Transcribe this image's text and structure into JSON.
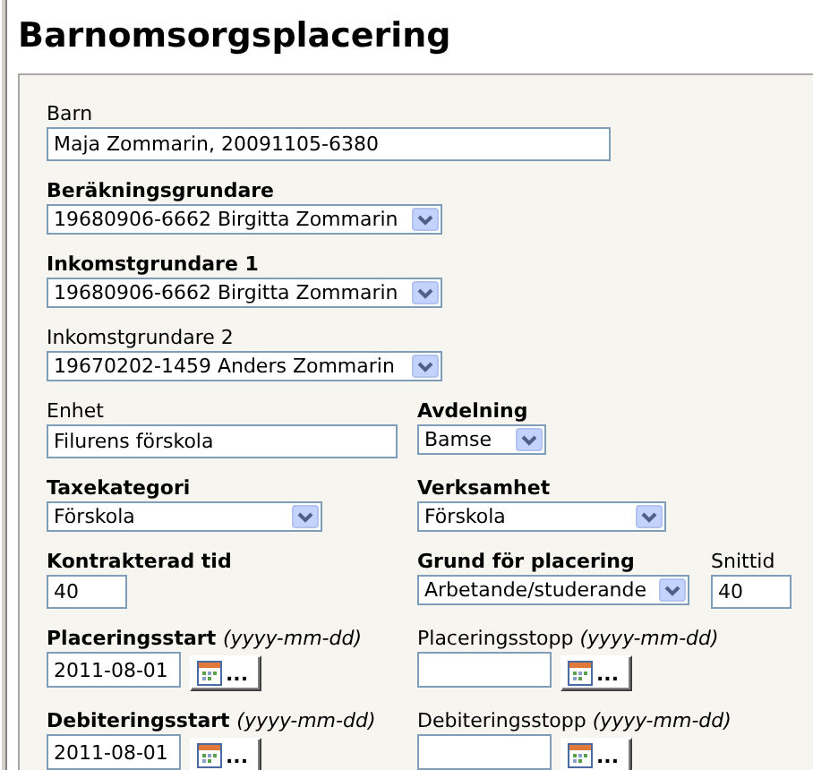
{
  "title": "Barnomsorgsplacering",
  "rows": [
    [
      {
        "kind": "text",
        "label": "Barn",
        "bold": false,
        "value": "Maja Zommarin, 20091105-6380"
      }
    ],
    [
      {
        "kind": "select",
        "label": "Beräkningsgrundare",
        "bold": true,
        "value": "19680906-6662 Birgitta Zommarin"
      }
    ],
    [
      {
        "kind": "select",
        "label": "Inkomstgrundare 1",
        "bold": true,
        "value": "19680906-6662 Birgitta Zommarin"
      }
    ],
    [
      {
        "kind": "select",
        "label": "Inkomstgrundare 2",
        "bold": false,
        "value": "19670202-1459 Anders Zommarin"
      }
    ],
    [
      {
        "kind": "text",
        "label": "Enhet",
        "bold": false,
        "value": "Filurens förskola"
      },
      {
        "kind": "select",
        "label": "Avdelning",
        "bold": true,
        "value": "Bamse"
      }
    ],
    [
      {
        "kind": "select",
        "label": "Taxekategori",
        "bold": true,
        "value": "Förskola"
      },
      {
        "kind": "select",
        "label": "Verksamhet",
        "bold": true,
        "value": "Förskola"
      }
    ],
    [
      {
        "kind": "text",
        "label": "Kontrakterad tid",
        "bold": true,
        "value": "40"
      },
      {
        "kind": "select",
        "label": "Grund för placering",
        "bold": true,
        "value": "Arbetande/studerande"
      },
      {
        "kind": "text",
        "label": "Snittid",
        "bold": false,
        "value": "40"
      }
    ],
    [
      {
        "kind": "date",
        "label": "Placeringsstart",
        "bold": true,
        "hint": "(yyyy-mm-dd)",
        "value": "2011-08-01",
        "button": "..."
      },
      {
        "kind": "date",
        "label": "Placeringsstopp",
        "bold": false,
        "hint": "(yyyy-mm-dd)",
        "button": "..."
      }
    ],
    [
      {
        "kind": "date",
        "label": "Debiteringsstart",
        "bold": true,
        "hint": "(yyyy-mm-dd)",
        "value": "2011-08-01",
        "button": "..."
      },
      {
        "kind": "date",
        "label": "Debiteringsstopp",
        "bold": false,
        "hint": "(yyyy-mm-dd)",
        "button": "..."
      }
    ]
  ]
}
